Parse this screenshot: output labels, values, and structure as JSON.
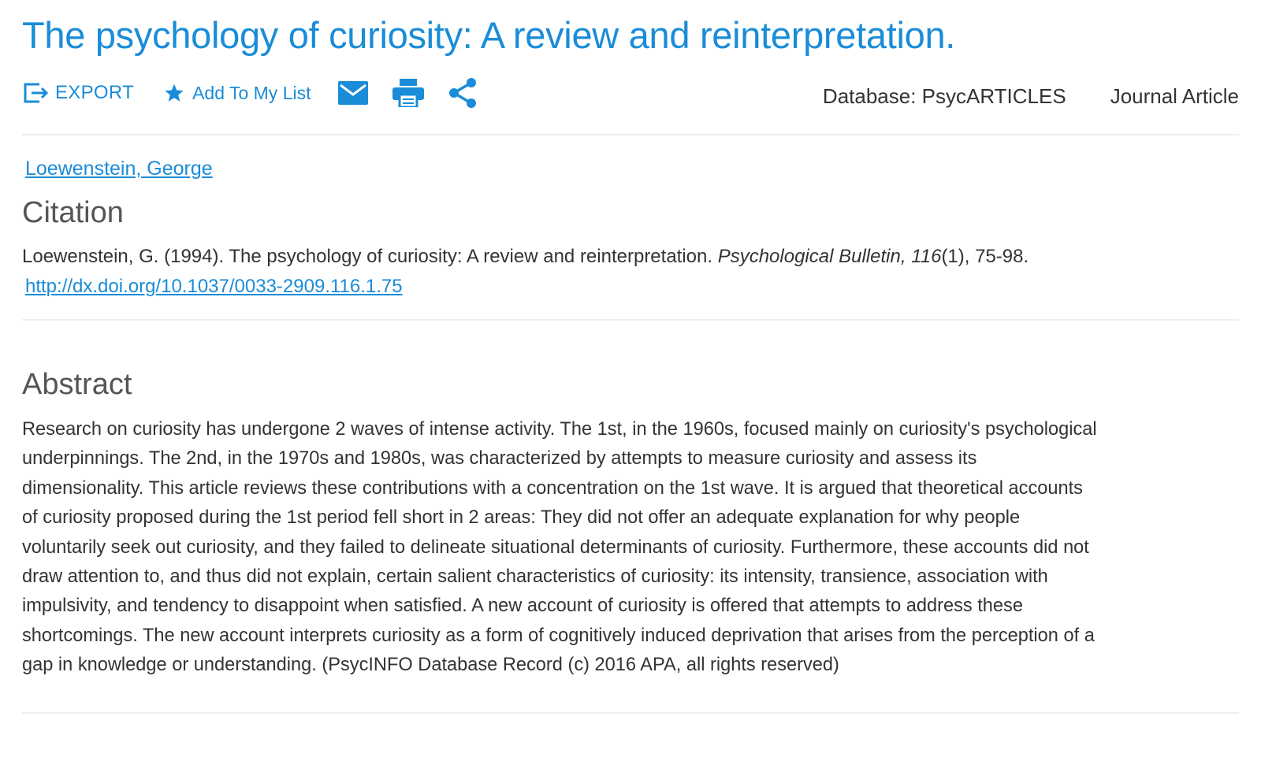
{
  "article": {
    "title": "The psychology of curiosity: A review and reinterpretation."
  },
  "toolbar": {
    "export_label": "EXPORT",
    "add_to_list_label": "Add To My List",
    "icons": [
      "export-icon",
      "star-icon",
      "email-icon",
      "print-icon",
      "share-icon"
    ]
  },
  "meta": {
    "database": "Database: PsycARTICLES",
    "type": "Journal Article"
  },
  "author": {
    "name": "Loewenstein, George"
  },
  "citation": {
    "heading": "Citation",
    "text_before": "Loewenstein, G. (1994). The psychology of curiosity: A review and reinterpretation. ",
    "journal": "Psychological Bulletin, 116",
    "text_after": "(1), 75-98.",
    "doi": "http://dx.doi.org/10.1037/0033-2909.116.1.75"
  },
  "abstract": {
    "heading": "Abstract",
    "lines": [
      "Research on curiosity has undergone 2 waves of intense activity. The 1st, in the 1960s, focused mainly on curiosity's psychological",
      "underpinnings. The 2nd, in the 1970s and 1980s, was characterized by attempts to measure curiosity and assess its",
      "dimensionality. This article reviews these contributions with a concentration on the 1st wave. It is argued that theoretical accounts",
      "of curiosity proposed during the 1st period fell short in 2 areas: They did not offer an adequate explanation for why people",
      "voluntarily seek out curiosity, and they failed to delineate situational determinants of curiosity. Furthermore, these accounts did not",
      "draw attention to, and thus did not explain, certain salient characteristics of curiosity: its intensity, transience, association with",
      "impulsivity, and tendency to disappoint when satisfied. A new account of curiosity is offered that attempts to address these",
      "shortcomings. The new account interprets curiosity as a form of cognitively induced deprivation that arises from the perception of a",
      "gap in knowledge or understanding. (PsycINFO Database Record (c) 2016 APA, all rights reserved)"
    ]
  },
  "colors": {
    "accent": "#1a8cd8",
    "text": "#333333",
    "heading": "#555555",
    "divider": "#eeeeee"
  }
}
